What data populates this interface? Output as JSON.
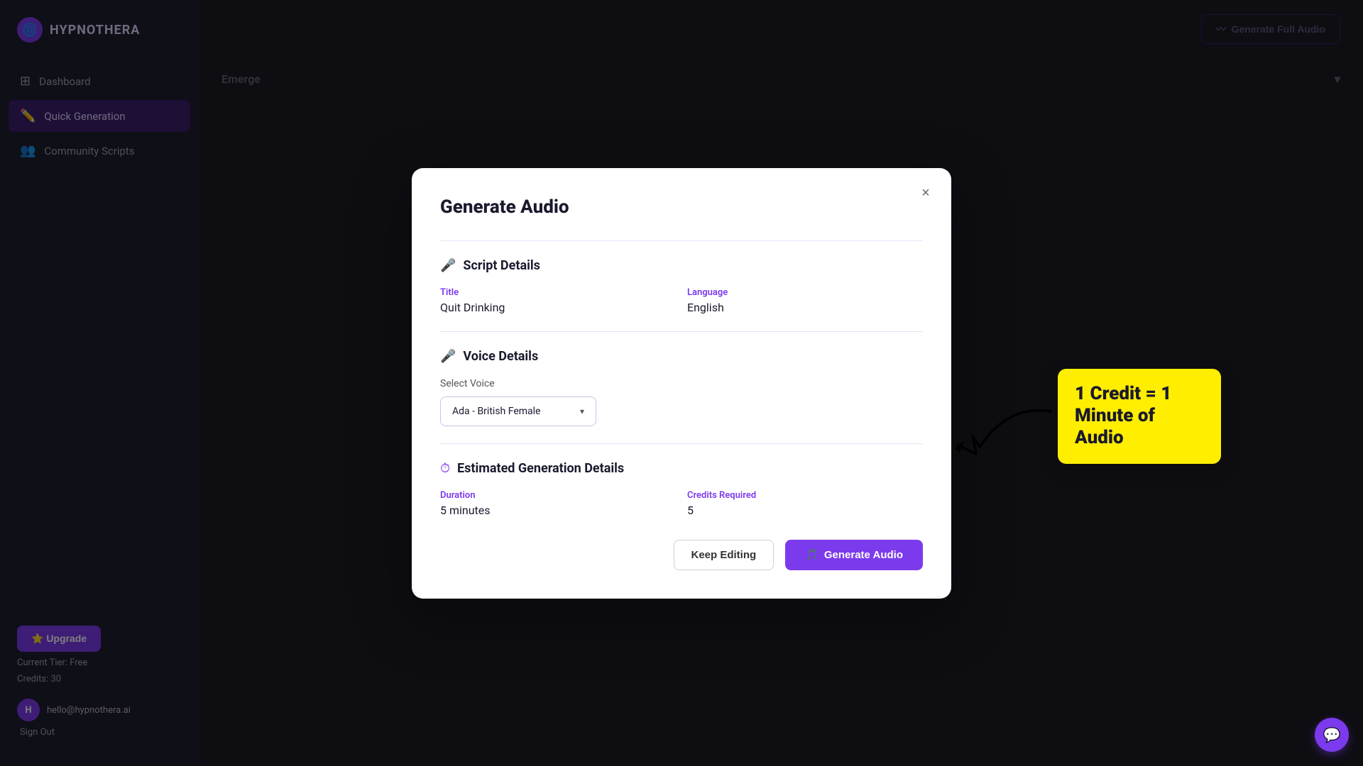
{
  "app": {
    "name": "HYPNOTHERA",
    "logo_symbol": "🌀"
  },
  "sidebar": {
    "items": [
      {
        "id": "dashboard",
        "label": "Dashboard",
        "icon": "⊞",
        "active": false
      },
      {
        "id": "quick-generation",
        "label": "Quick Generation",
        "icon": "✏️",
        "active": true
      },
      {
        "id": "community-scripts",
        "label": "Community Scripts",
        "icon": "👥",
        "active": false
      }
    ],
    "upgrade_label": "⭐ Upgrade",
    "tier_label": "Current Tier: Free",
    "credits_label": "Credits: 30",
    "user_email": "hello@hypnothera.ai",
    "user_initial": "H",
    "sign_out_label": "Sign Out"
  },
  "main": {
    "generate_full_audio_label": "Generate Full Audio"
  },
  "modal": {
    "title": "Generate Audio",
    "close_label": "×",
    "sections": {
      "script_details": {
        "icon": "🎤",
        "title": "Script Details",
        "title_label_field": "Title",
        "title_value": "Quit Drinking",
        "language_label": "Language",
        "language_value": "English"
      },
      "voice_details": {
        "icon": "🎤",
        "title": "Voice Details",
        "select_voice_label": "Select Voice",
        "selected_voice": "Ada - British Female",
        "chevron": "▾"
      },
      "estimated": {
        "icon": "⏱",
        "title": "Estimated Generation Details",
        "duration_label": "Duration",
        "duration_value": "5 minutes",
        "credits_label": "Credits Required",
        "credits_value": "5"
      }
    },
    "keep_editing_label": "Keep Editing",
    "generate_label": "Generate Audio",
    "generate_icon": "🎵"
  },
  "tooltip": {
    "line1": "1 Credit = 1",
    "line2": "Minute of",
    "line3": "Audio"
  },
  "background_accordions": [
    "Emerge"
  ]
}
